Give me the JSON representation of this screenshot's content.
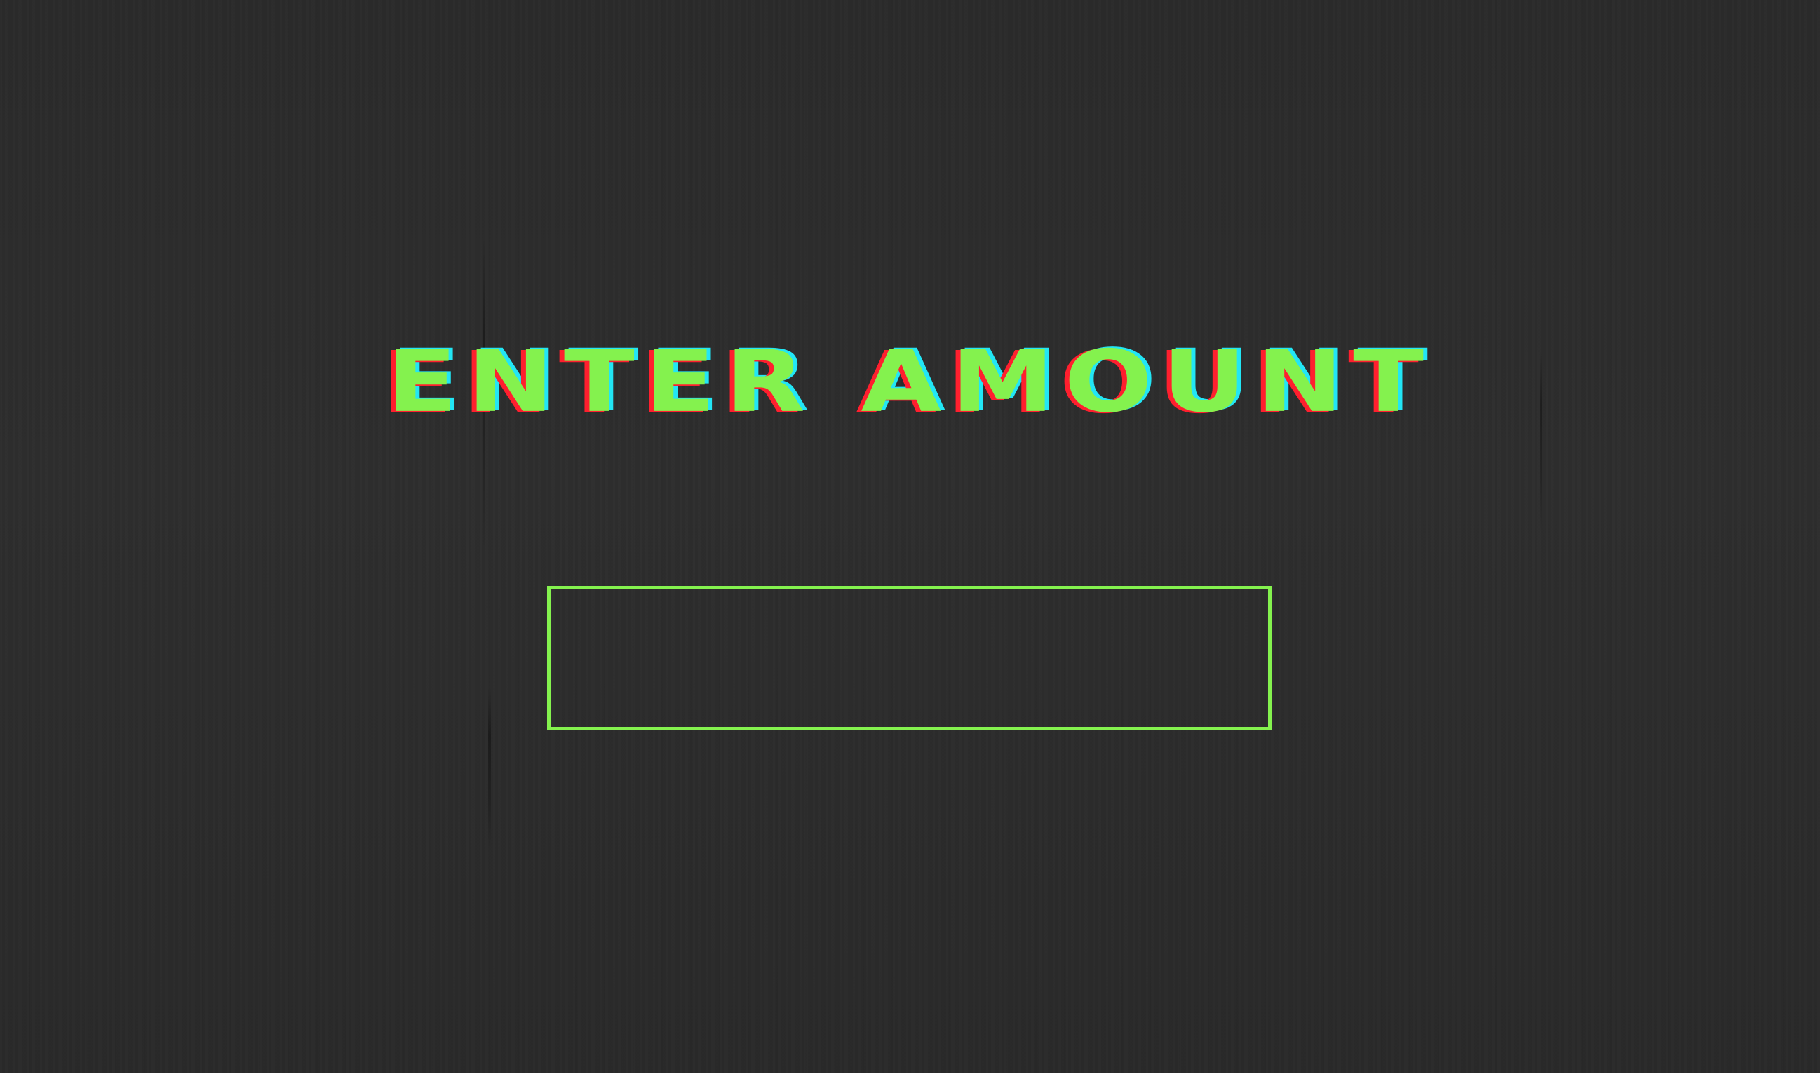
{
  "screen": {
    "title": "ENTER AMOUNT"
  },
  "amount_input": {
    "value": "",
    "placeholder": ""
  },
  "colors": {
    "background": "#2d2d2d",
    "accent_green": "#84f24e",
    "glitch_red": "#ff1f2e",
    "glitch_cyan": "#22e6f5"
  }
}
